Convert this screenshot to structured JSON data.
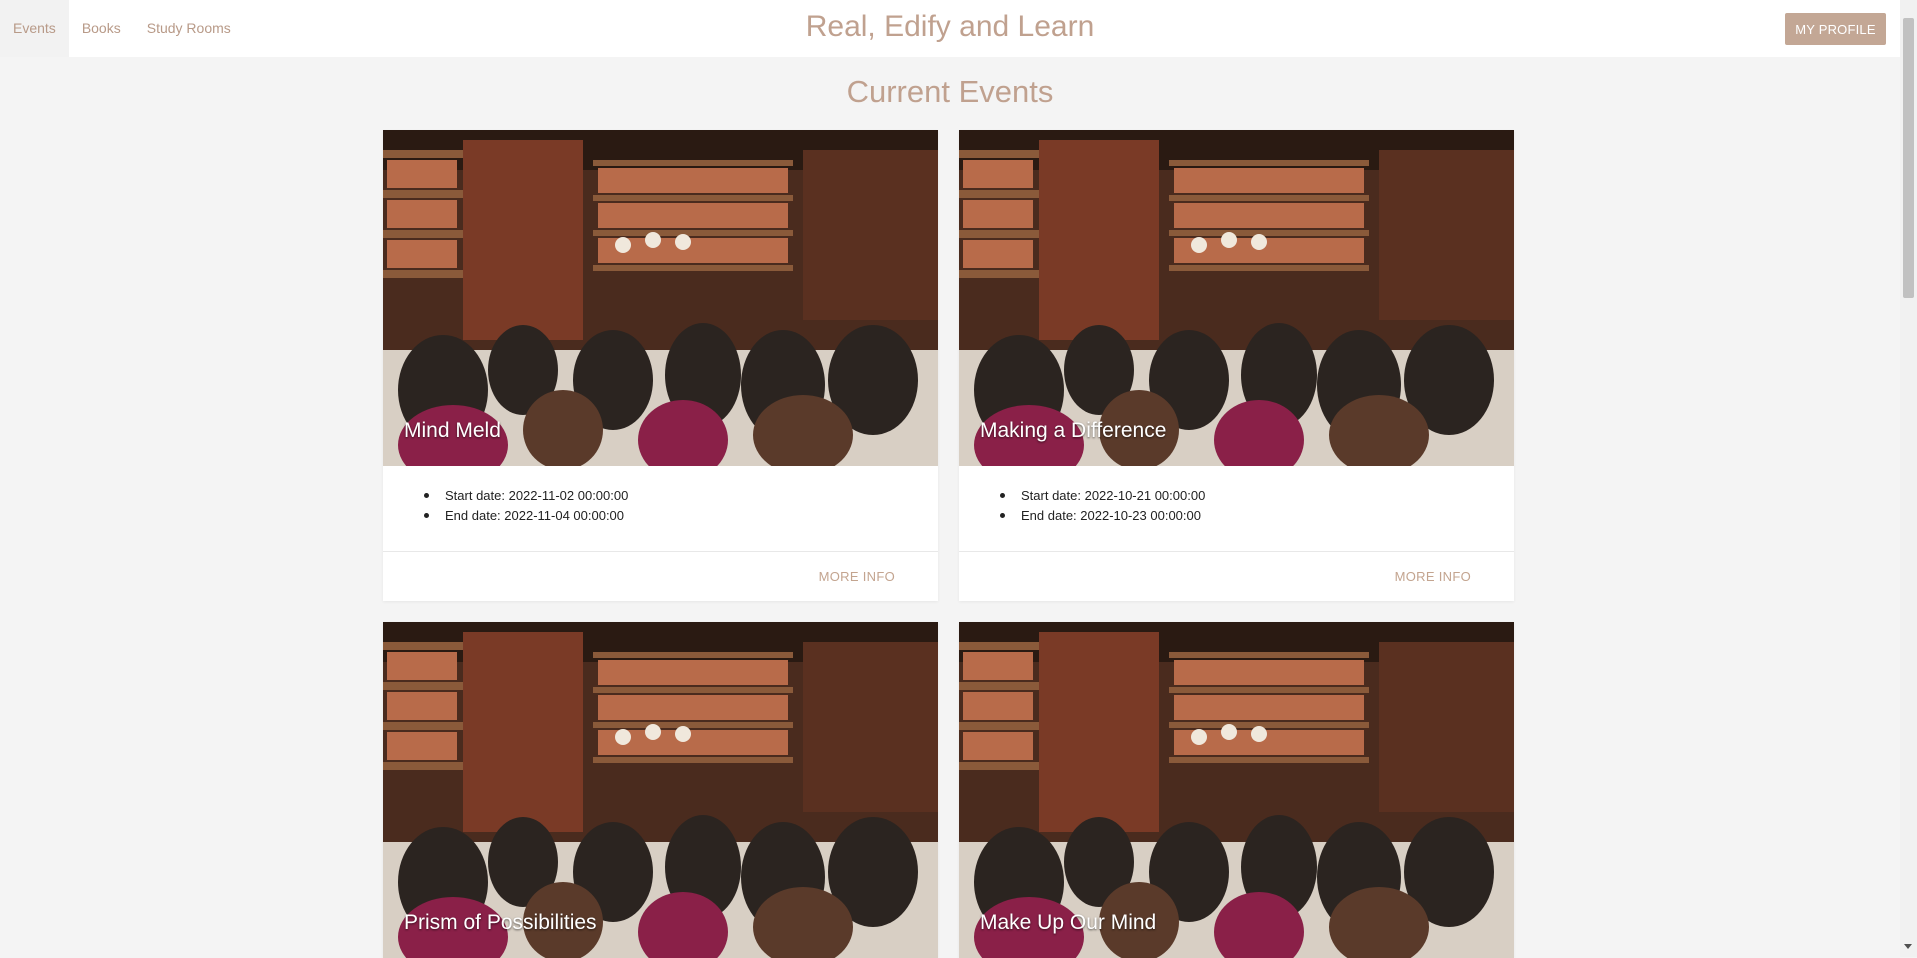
{
  "nav": {
    "items": [
      {
        "label": "Events",
        "active": true
      },
      {
        "label": "Books",
        "active": false
      },
      {
        "label": "Study Rooms",
        "active": false
      }
    ]
  },
  "header": {
    "title": "Real, Edify and Learn",
    "profile_label": "MY PROFILE"
  },
  "main": {
    "heading": "Current Events",
    "cards": [
      {
        "title": "Mind Meld",
        "start_label": "Start date: 2022-11-02 00:00:00",
        "end_label": "End date: 2022-11-04 00:00:00",
        "action_label": "MORE INFO"
      },
      {
        "title": "Making a Difference",
        "start_label": "Start date: 2022-10-21 00:00:00",
        "end_label": "End date: 2022-10-23 00:00:00",
        "action_label": "MORE INFO"
      },
      {
        "title": "Prism of Possibilities"
      },
      {
        "title": "Make Up Our Mind"
      }
    ]
  },
  "colors": {
    "accent": "#c0a18f",
    "button": "#c3a795",
    "background": "#f4f4f4"
  }
}
